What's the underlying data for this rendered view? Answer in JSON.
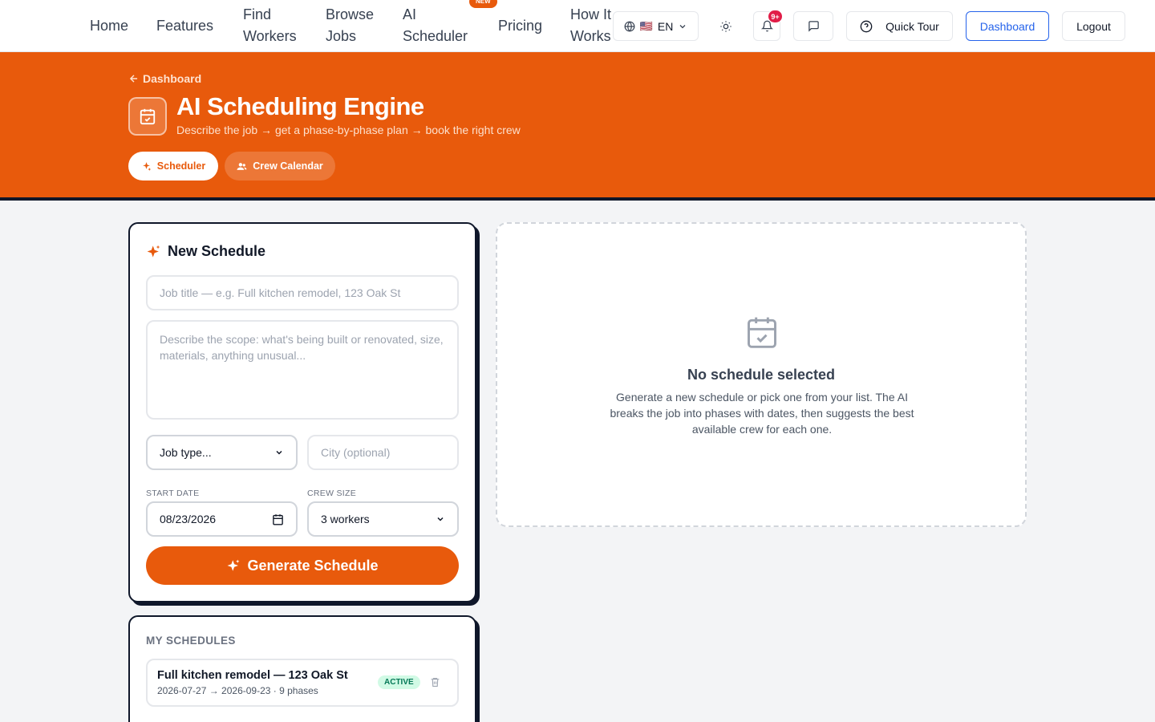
{
  "nav": {
    "links": [
      "Home",
      "Features",
      "Find Workers",
      "Browse Jobs",
      "AI Scheduler",
      "Pricing",
      "How It Works"
    ],
    "new_badge": "NEW",
    "language": {
      "flag": "🇺🇸",
      "code": "EN"
    },
    "notifications_count": "9+",
    "quick_tour": "Quick Tour",
    "dashboard": "Dashboard",
    "logout": "Logout"
  },
  "hero": {
    "back_label": "Dashboard",
    "title": "AI Scheduling Engine",
    "subtitle": "Describe the job → get a phase-by-phase plan → book the right crew",
    "tabs": [
      {
        "label": "Scheduler",
        "active": true,
        "icon": "sparkle-icon"
      },
      {
        "label": "Crew Calendar",
        "active": false,
        "icon": "users-icon"
      }
    ]
  },
  "form": {
    "title": "New Schedule",
    "job_title_placeholder": "Job title — e.g. Full kitchen remodel, 123 Oak St",
    "scope_placeholder": "Describe the scope: what's being built or renovated, size, materials, anything unusual...",
    "job_type_value": "Job type...",
    "city_placeholder": "City (optional)",
    "start_date_label": "START DATE",
    "start_date_value": "08/23/2026",
    "crew_size_label": "CREW SIZE",
    "crew_size_value": "3 workers",
    "generate_label": "Generate Schedule"
  },
  "empty_state": {
    "title": "No schedule selected",
    "description": "Generate a new schedule or pick one from your list. The AI breaks the job into phases with dates, then suggests the best available crew for each one."
  },
  "schedules": {
    "title": "MY SCHEDULES",
    "items": [
      {
        "name": "Full kitchen remodel — 123 Oak St",
        "meta": "2026-07-27 → 2026-09-23 · 9 phases",
        "status": "ACTIVE"
      }
    ]
  },
  "colors": {
    "accent": "#e85a0c",
    "ink": "#0f172a",
    "active": "#047857"
  }
}
